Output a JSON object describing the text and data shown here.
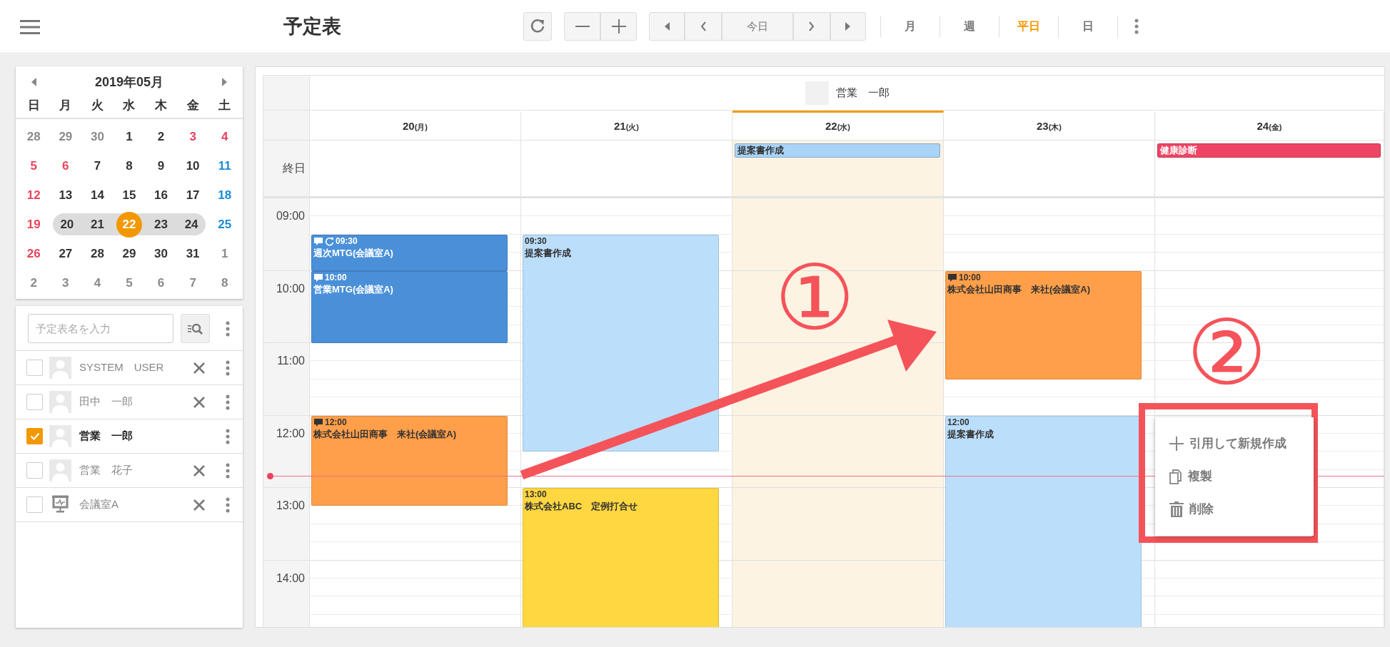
{
  "app_bar": {
    "title": "予定表",
    "today_button": "今日",
    "views": [
      {
        "label": "月",
        "selected": false
      },
      {
        "label": "週",
        "selected": false
      },
      {
        "label": "平日",
        "selected": true
      },
      {
        "label": "日",
        "selected": false
      }
    ]
  },
  "mini_calendar": {
    "title": "2019年05月",
    "weekdays": [
      "日",
      "月",
      "火",
      "水",
      "木",
      "金",
      "土"
    ],
    "weeks": [
      [
        {
          "text": "28",
          "color": "#8a8a8a",
          "selected": false,
          "today": false
        },
        {
          "text": "29",
          "color": "#8a8a8a",
          "selected": false,
          "today": false
        },
        {
          "text": "30",
          "color": "#8a8a8a",
          "selected": false,
          "today": false
        },
        {
          "text": "1",
          "color": "#333333",
          "selected": false,
          "today": false
        },
        {
          "text": "2",
          "color": "#333333",
          "selected": false,
          "today": false
        },
        {
          "text": "3",
          "color": "#e8435a",
          "selected": false,
          "today": false
        },
        {
          "text": "4",
          "color": "#e8435a",
          "selected": false,
          "today": false
        }
      ],
      [
        {
          "text": "5",
          "color": "#e8435a",
          "selected": false,
          "today": false
        },
        {
          "text": "6",
          "color": "#e8435a",
          "selected": false,
          "today": false
        },
        {
          "text": "7",
          "color": "#333333",
          "selected": false,
          "today": false
        },
        {
          "text": "8",
          "color": "#333333",
          "selected": false,
          "today": false
        },
        {
          "text": "9",
          "color": "#333333",
          "selected": false,
          "today": false
        },
        {
          "text": "10",
          "color": "#333333",
          "selected": false,
          "today": false
        },
        {
          "text": "11",
          "color": "#1a8ad4",
          "selected": false,
          "today": false
        }
      ],
      [
        {
          "text": "12",
          "color": "#e8435a",
          "selected": false,
          "today": false
        },
        {
          "text": "13",
          "color": "#333333",
          "selected": false,
          "today": false
        },
        {
          "text": "14",
          "color": "#333333",
          "selected": false,
          "today": false
        },
        {
          "text": "15",
          "color": "#333333",
          "selected": false,
          "today": false
        },
        {
          "text": "16",
          "color": "#333333",
          "selected": false,
          "today": false
        },
        {
          "text": "17",
          "color": "#333333",
          "selected": false,
          "today": false
        },
        {
          "text": "18",
          "color": "#1a8ad4",
          "selected": false,
          "today": false
        }
      ],
      [
        {
          "text": "19",
          "color": "#e8435a",
          "selected": false,
          "today": false
        },
        {
          "text": "20",
          "color": "#333333",
          "selected": true,
          "today": false
        },
        {
          "text": "21",
          "color": "#333333",
          "selected": true,
          "today": false
        },
        {
          "text": "22",
          "color": "#f39800",
          "selected": true,
          "today": true
        },
        {
          "text": "23",
          "color": "#333333",
          "selected": true,
          "today": false
        },
        {
          "text": "24",
          "color": "#333333",
          "selected": true,
          "today": false
        },
        {
          "text": "25",
          "color": "#1a8ad4",
          "selected": false,
          "today": false
        }
      ],
      [
        {
          "text": "26",
          "color": "#e8435a",
          "selected": false,
          "today": false
        },
        {
          "text": "27",
          "color": "#333333",
          "selected": false,
          "today": false
        },
        {
          "text": "28",
          "color": "#333333",
          "selected": false,
          "today": false
        },
        {
          "text": "29",
          "color": "#333333",
          "selected": false,
          "today": false
        },
        {
          "text": "30",
          "color": "#333333",
          "selected": false,
          "today": false
        },
        {
          "text": "31",
          "color": "#333333",
          "selected": false,
          "today": false
        },
        {
          "text": "1",
          "color": "#8a8a8a",
          "selected": false,
          "today": false
        }
      ],
      [
        {
          "text": "2",
          "color": "#8a8a8a",
          "selected": false,
          "today": false
        },
        {
          "text": "3",
          "color": "#8a8a8a",
          "selected": false,
          "today": false
        },
        {
          "text": "4",
          "color": "#8a8a8a",
          "selected": false,
          "today": false
        },
        {
          "text": "5",
          "color": "#8a8a8a",
          "selected": false,
          "today": false
        },
        {
          "text": "6",
          "color": "#8a8a8a",
          "selected": false,
          "today": false
        },
        {
          "text": "7",
          "color": "#8a8a8a",
          "selected": false,
          "today": false
        },
        {
          "text": "8",
          "color": "#8a8a8a",
          "selected": false,
          "today": false
        }
      ]
    ]
  },
  "schedule_list": {
    "search": {
      "placeholder": "予定表名を入力"
    },
    "items": [
      {
        "name": "SYSTEM　USER",
        "kind": "person",
        "checked": false,
        "removable": true
      },
      {
        "name": "田中　一郎",
        "kind": "person",
        "checked": false,
        "removable": true
      },
      {
        "name": "営業　一郎",
        "kind": "person",
        "checked": true,
        "removable": false
      },
      {
        "name": "営業　花子",
        "kind": "person",
        "checked": false,
        "removable": true
      },
      {
        "name": "会議室A",
        "kind": "room",
        "checked": false,
        "removable": true
      }
    ]
  },
  "schedule": {
    "owner": "営業　一郎",
    "all_day_label": "終日",
    "hours": [
      "09:00",
      "10:00",
      "11:00",
      "12:00",
      "13:00",
      "14:00"
    ],
    "days": [
      {
        "date": "20",
        "weekday": "(月)",
        "today": false,
        "events": [
          {
            "start": "09:30",
            "title": "週次MTG(会議室A)",
            "color": "#4a90d9",
            "comment": true,
            "recurring": true
          },
          {
            "start": "10:00",
            "title": "営業MTG(会議室A)",
            "color": "#4a90d9",
            "comment": true,
            "recurring": false
          },
          {
            "start": "12:00",
            "title": "株式会社山田商事　来社(会議室A)",
            "color": "#ff9f4a",
            "comment": true,
            "recurring": false
          }
        ]
      },
      {
        "date": "21",
        "weekday": "(火)",
        "today": false,
        "events": [
          {
            "start": "09:30",
            "title": "提案書作成",
            "color": "#bbdefb",
            "comment": false,
            "recurring": false
          },
          {
            "start": "13:00",
            "title": "株式会社ABC　定例打合せ",
            "color": "#ffd740",
            "comment": false,
            "recurring": false
          }
        ]
      },
      {
        "date": "22",
        "weekday": "(水)",
        "today": true,
        "all_day_events": [
          {
            "title": "提案書作成",
            "color": "#a9d4f7"
          }
        ]
      },
      {
        "date": "23",
        "weekday": "(木)",
        "today": false,
        "events": [
          {
            "start": "10:00",
            "title": "株式会社山田商事　来社(会議室A)",
            "color": "#ff9f4a",
            "comment": true,
            "recurring": false
          },
          {
            "start": "12:00",
            "title": "提案書作成",
            "color": "#bbdefb",
            "comment": false,
            "recurring": false
          }
        ]
      },
      {
        "date": "24",
        "weekday": "(金)",
        "today": false,
        "all_day_events": [
          {
            "title": "健康診断",
            "color": "#ef4565"
          }
        ]
      }
    ]
  },
  "context_menu": {
    "items": [
      {
        "kind": "plus",
        "label": "引用して新規作成"
      },
      {
        "kind": "copy",
        "label": "複製"
      },
      {
        "kind": "trash",
        "label": "削除"
      }
    ]
  },
  "annotations": [
    {
      "kind": "number",
      "text": "①"
    },
    {
      "kind": "arrow"
    },
    {
      "kind": "number",
      "text": "②"
    },
    {
      "kind": "box"
    }
  ]
}
